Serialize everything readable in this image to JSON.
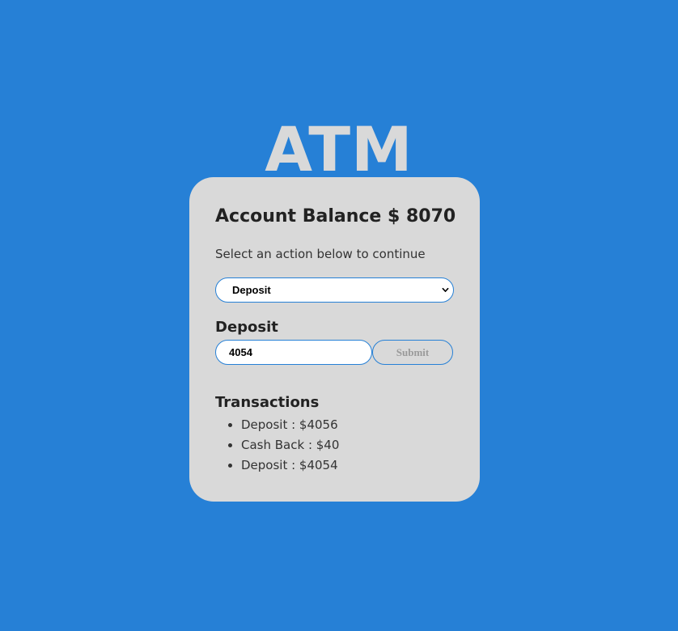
{
  "title": "ATM",
  "account": {
    "balance_label": "Account Balance $",
    "balance_value": "8070"
  },
  "instruction": "Select an action below to continue",
  "action_select": {
    "selected": "Deposit",
    "icon": "chevron-down-icon"
  },
  "form": {
    "label": "Deposit",
    "input_value": "4054",
    "submit_label": "Submit"
  },
  "transactions": {
    "heading": "Transactions",
    "items": [
      "Deposit : $4056",
      "Cash Back : $40",
      "Deposit : $4054"
    ]
  },
  "colors": {
    "background": "#2680d6",
    "card": "#d9d9d9",
    "accent_border": "#2680d6",
    "title": "#d9d9d9",
    "disabled_text": "#9a9a9a"
  }
}
